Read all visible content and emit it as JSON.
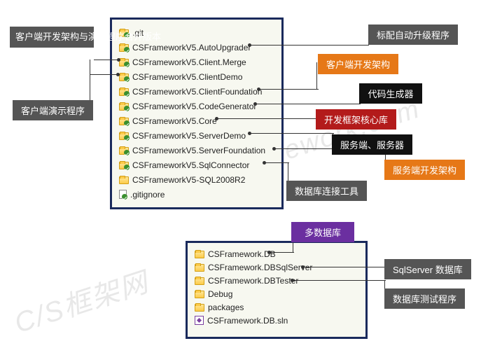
{
  "watermark1": "C/S框架网",
  "watermark2": "www.csframework.com",
  "panel1": {
    "items": [
      {
        "icon": "folder-green",
        "text": ".git"
      },
      {
        "icon": "folder-green",
        "text": "CSFrameworkV5.AutoUpgrader"
      },
      {
        "icon": "folder-green",
        "text": "CSFrameworkV5.Client.Merge"
      },
      {
        "icon": "folder-green",
        "text": "CSFrameworkV5.ClientDemo"
      },
      {
        "icon": "folder-green",
        "text": "CSFrameworkV5.ClientFoundation"
      },
      {
        "icon": "folder-green",
        "text": "CSFrameworkV5.CodeGenerator"
      },
      {
        "icon": "folder-green",
        "text": "CSFrameworkV5.Core"
      },
      {
        "icon": "folder-green",
        "text": "CSFrameworkV5.ServerDemo"
      },
      {
        "icon": "folder-green",
        "text": "CSFrameworkV5.ServerFoundation"
      },
      {
        "icon": "folder-green",
        "text": "CSFrameworkV5.SqlConnector"
      },
      {
        "icon": "folder",
        "text": "CSFrameworkV5-SQL2008R2"
      },
      {
        "icon": "file-green",
        "text": ".gitignore"
      }
    ]
  },
  "panel2": {
    "items": [
      {
        "icon": "folder",
        "text": "CSFramework.DB"
      },
      {
        "icon": "folder",
        "text": "CSFramework.DBSqlServer"
      },
      {
        "icon": "folder",
        "text": "CSFramework.DBTester"
      },
      {
        "icon": "folder",
        "text": "Debug"
      },
      {
        "icon": "folder",
        "text": "packages"
      },
      {
        "icon": "sln",
        "text": "CSFramework.DB.sln"
      }
    ]
  },
  "labels": {
    "l1": "客户端开发架构与演示程序合并版本",
    "l2": "客户端演示程序",
    "l3": "标配自动升级程序",
    "l4": "客户端开发架构",
    "l5": "代码生成器",
    "l6": "开发框架核心库",
    "l7": "服务端、服务器",
    "l8": "服务端开发架构",
    "l9": "数据库连接工具",
    "l10": "多数据库",
    "l11": "SqlServer 数据库",
    "l12": "数据库测试程序"
  }
}
